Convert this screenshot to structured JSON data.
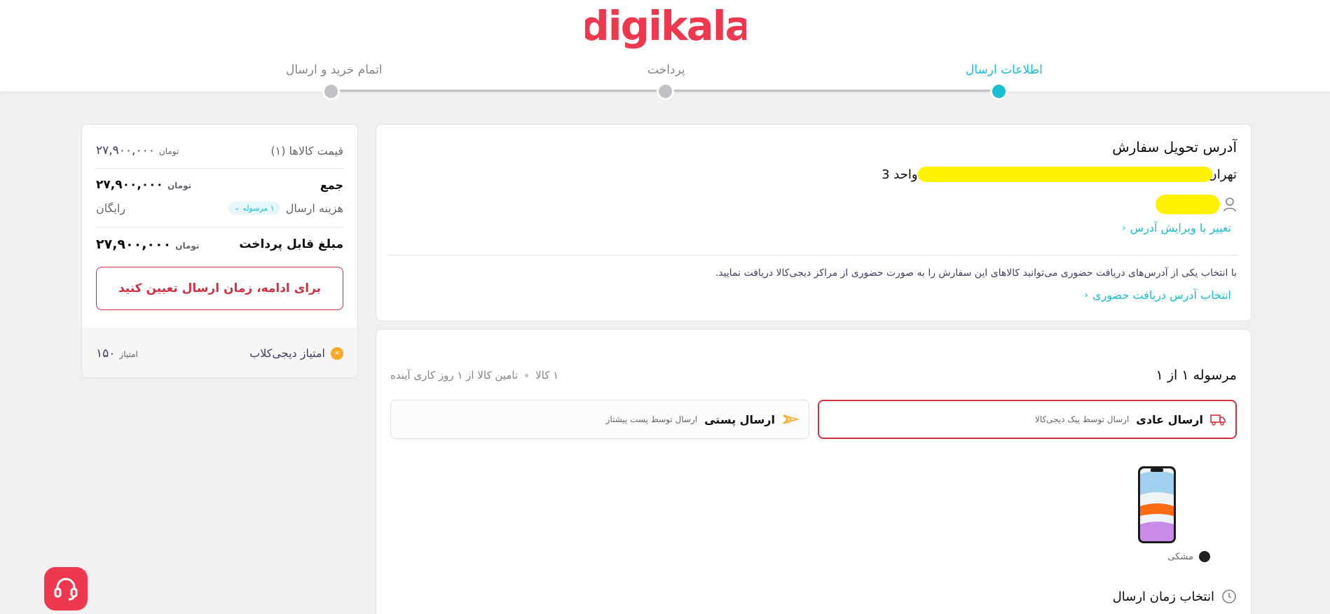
{
  "brand": {
    "logo_text": "digikala",
    "brand_color": "#ee384e",
    "accent": "#19bfd3"
  },
  "steps": [
    {
      "label": "اطلاعات ارسال",
      "state": "active"
    },
    {
      "label": "پرداخت",
      "state": "pending"
    },
    {
      "label": "اتمام خرید و ارسال",
      "state": "pending"
    }
  ],
  "address": {
    "title": "آدرس تحویل سفارش",
    "city_prefix": "تهران",
    "unit_suffix": "واحد 3",
    "change_link": "تغییر یا ویرایش آدرس",
    "pickup_note": "با انتخاب یکی از آدرس‌های دریافت حضوری می‌توانید کالاهای این سفارش را به صورت حضوری از مراکز دیجی‌کالا دریافت نمایید.",
    "pickup_link": "انتخاب آدرس دریافت حضوری"
  },
  "shipment": {
    "title": "مرسوله ۱ از ۱",
    "item_count": "۱ کالا",
    "supply_time": "تامین کالا از ۱ روز کاری آینده",
    "options": [
      {
        "name": "ارسال عادی",
        "desc": "ارسال توسط پیک دیجی‌کالا",
        "icon": "truck-icon",
        "selected": true
      },
      {
        "name": "ارسال پستی",
        "desc": "ارسال توسط پست پیشتاز",
        "icon": "post-icon",
        "selected": false
      }
    ],
    "product_color": "مشکی",
    "time_select": "انتخاب زمان ارسال"
  },
  "summary": {
    "items_price_label": "قیمت کالاها (۱)",
    "items_price": "۲۷,۹۰۰,۰۰۰",
    "currency": "تومان",
    "total_label": "جمع",
    "total": "۲۷,۹۰۰,۰۰۰",
    "shipping_label": "هزینه ارسال",
    "shipping_badge": "۱ مرسوله",
    "shipping_value": "رایگان",
    "payable_label": "مبلغ قابل پرداخت",
    "payable": "۲۷,۹۰۰,۰۰۰",
    "cta": "برای ادامه، زمان ارسال تعیین کنید",
    "club_label": "امتیاز دیجی‌کلاب",
    "club_points": "۱۵۰",
    "club_unit": "امتیاز"
  }
}
